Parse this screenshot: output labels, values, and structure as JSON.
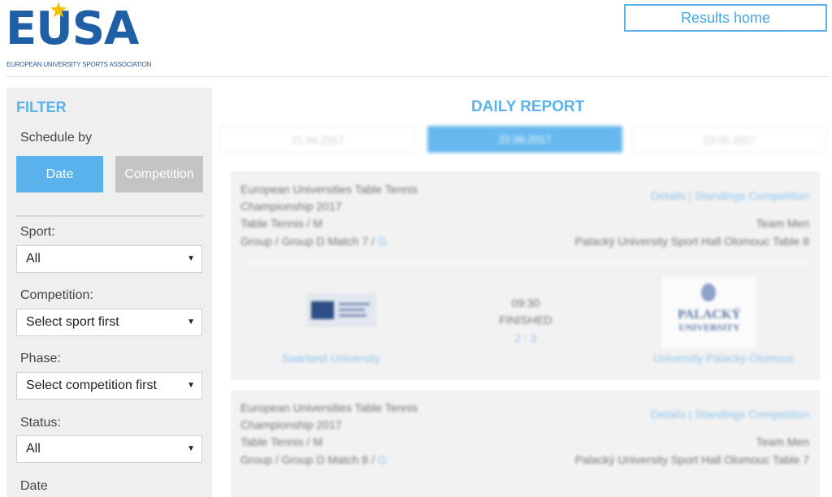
{
  "header": {
    "logo_text": "EUSA",
    "logo_subtitle": "EUROPEAN UNIVERSITY SPORTS ASSOCIATION",
    "results_home": "Results home"
  },
  "filter": {
    "title": "FILTER",
    "schedule_by_label": "Schedule by",
    "schedule_buttons": {
      "date": "Date",
      "competition": "Competition"
    },
    "sport": {
      "label": "Sport:",
      "value": "All"
    },
    "competition": {
      "label": "Competition:",
      "value": "Select sport first"
    },
    "phase": {
      "label": "Phase:",
      "value": "Select competition first"
    },
    "status": {
      "label": "Status:",
      "value": "All"
    },
    "date_label": "Date"
  },
  "report": {
    "title": "DAILY REPORT",
    "date_tabs": [
      "21.06.2017",
      "22.06.2017",
      "23.06.2017"
    ],
    "active_tab": 1,
    "matches": [
      {
        "competition": "European Universities Table Tennis Championship 2017",
        "links": "Details | Standings Competition",
        "sport": "Table Tennis / M",
        "category": "Team Men",
        "group": "Group / Group D Match 7 /",
        "group_link": "G",
        "venue": "Palacký University Sport Hall Olomouc Table 8",
        "time": "09:30",
        "status": "FINISHED",
        "score": "2 : 3",
        "team_home": "Saarland University",
        "team_away": "University Palacky Olomouc",
        "away_logo_line1": "PALACKÝ",
        "away_logo_line2": "UNIVERSITY"
      },
      {
        "competition": "European Universities Table Tennis Championship 2017",
        "links": "Details | Standings Competition",
        "sport": "Table Tennis / M",
        "category": "Team Men",
        "group": "Group / Group D Match 8 /",
        "group_link": "G",
        "venue": "Palacký University Sport Hall Olomouc Table 7"
      }
    ]
  },
  "colors": {
    "accent": "#5ab2ec",
    "logo_blue": "#1f5fa5",
    "sidebar_bg": "#efefef"
  }
}
